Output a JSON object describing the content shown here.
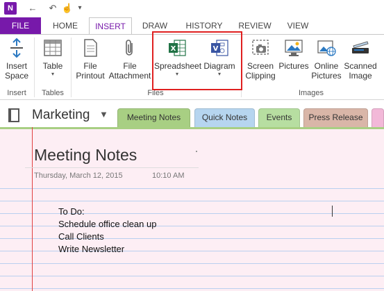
{
  "qat": {
    "app_icon_label": "N",
    "back_glyph": "←",
    "undo_glyph": "↶",
    "touch_glyph": "☝",
    "more_glyph": "▾"
  },
  "tabs": [
    {
      "label": "FILE"
    },
    {
      "label": "HOME"
    },
    {
      "label": "INSERT"
    },
    {
      "label": "DRAW"
    },
    {
      "label": "HISTORY"
    },
    {
      "label": "REVIEW"
    },
    {
      "label": "VIEW"
    }
  ],
  "ribbon": {
    "insert_space": {
      "line1": "Insert",
      "line2": "Space"
    },
    "table": {
      "line1": "Table"
    },
    "file_printout": {
      "line1": "File",
      "line2": "Printout"
    },
    "file_attachment": {
      "line1": "File",
      "line2": "Attachment"
    },
    "spreadsheet": {
      "line1": "Spreadsheet"
    },
    "diagram": {
      "line1": "Diagram"
    },
    "screen_clipping": {
      "line1": "Screen",
      "line2": "Clipping"
    },
    "pictures": {
      "line1": "Pictures"
    },
    "online_pictures": {
      "line1": "Online",
      "line2": "Pictures"
    },
    "scanned_image": {
      "line1": "Scanned",
      "line2": "Image"
    },
    "groups": {
      "insert": "Insert",
      "tables": "Tables",
      "files": "Files",
      "images": "Images"
    },
    "dropdown_glyph": "▾"
  },
  "notebook": {
    "name": "Marketing",
    "caret": "▼"
  },
  "section_tabs": [
    {
      "label": "Meeting Notes",
      "color": "#a8cf83"
    },
    {
      "label": "Quick Notes",
      "color": "#b6d5ef"
    },
    {
      "label": "Events",
      "color": "#b7dea1"
    },
    {
      "label": "Press Release",
      "color": "#d9b6a8"
    }
  ],
  "page": {
    "title": "Meeting Notes",
    "date": "Thursday, March 12, 2015",
    "time": "10:10 AM",
    "lines": [
      "To Do:",
      "Schedule office clean up",
      "Call Clients",
      "Write Newsletter"
    ]
  },
  "colors": {
    "accent": "#7719aa",
    "highlight": "#e02020",
    "margin": "#e04040"
  }
}
